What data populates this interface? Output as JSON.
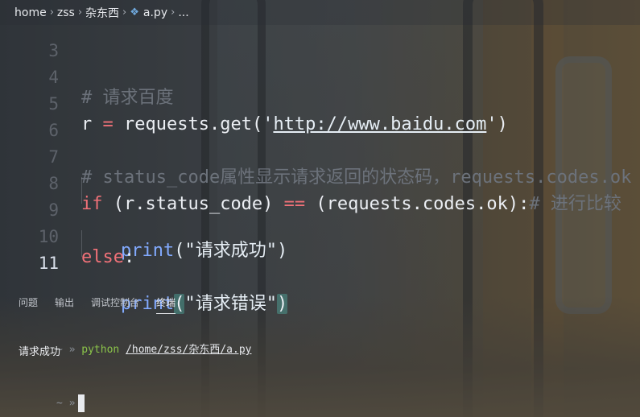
{
  "breadcrumb": {
    "items": [
      "home",
      "zss",
      "杂东西",
      "a.py",
      "..."
    ],
    "file_icon": "python-icon"
  },
  "editor": {
    "lines": [
      {
        "num": "3"
      },
      {
        "num": "4",
        "comment": "# 请求百度"
      },
      {
        "num": "5",
        "var": "r",
        "eq": "=",
        "call": "requests.get(",
        "q1": "'",
        "url": "http://www.baidu.com",
        "q2": "'",
        "close": ")"
      },
      {
        "num": "6"
      },
      {
        "num": "7",
        "comment": "# status_code属性显示请求返回的状态码，requests.codes.ok"
      },
      {
        "num": "8",
        "kw": "if",
        "cond1": " (r.status_code) ",
        "op": "==",
        "cond2": " (requests.codes.ok):",
        "comment": "# 进行比较"
      },
      {
        "num": "9",
        "fn": "print",
        "args": "(\"请求成功\")"
      },
      {
        "num": "10",
        "kw": "else",
        "colon": ":"
      },
      {
        "num": "11",
        "fn": "print",
        "open": "(",
        "str": "\"请求错误\"",
        "close": ")"
      }
    ],
    "active_line": "11"
  },
  "panel": {
    "tabs": [
      "问题",
      "输出",
      "调试控制台",
      "终端"
    ],
    "active_tab": "终端"
  },
  "terminal": {
    "prompt": "~ »",
    "command": "python",
    "path": "/home/zss/杂东西/a.py",
    "output": "请求成功",
    "prompt2": "~ »"
  }
}
